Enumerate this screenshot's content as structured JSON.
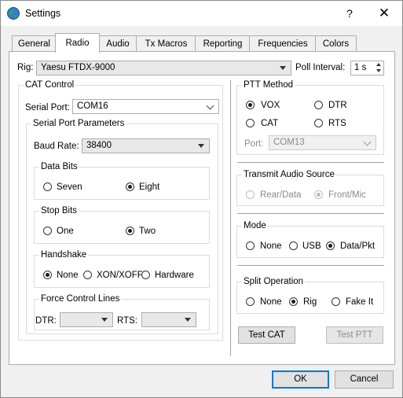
{
  "window": {
    "title": "Settings",
    "help_glyph": "?",
    "close_glyph": "✕",
    "icon": "globe-icon"
  },
  "tabs": [
    "General",
    "Radio",
    "Audio",
    "Tx Macros",
    "Reporting",
    "Frequencies",
    "Colors"
  ],
  "active_tab": "Radio",
  "rig": {
    "label": "Rig:",
    "value": "Yaesu FTDX-9000"
  },
  "poll_interval": {
    "label": "Poll Interval:",
    "value": "1 s"
  },
  "cat_control": {
    "title": "CAT Control",
    "serial_port_label": "Serial Port:",
    "serial_port_value": "COM16",
    "serial_params": {
      "title": "Serial Port Parameters",
      "baud_rate_label": "Baud Rate:",
      "baud_rate_value": "38400",
      "data_bits": {
        "title": "Data Bits",
        "options": [
          "Seven",
          "Eight"
        ],
        "selected": "Eight"
      },
      "stop_bits": {
        "title": "Stop Bits",
        "options": [
          "One",
          "Two"
        ],
        "selected": "Two"
      },
      "handshake": {
        "title": "Handshake",
        "options": [
          "None",
          "XON/XOFF",
          "Hardware"
        ],
        "selected": "None"
      },
      "force_control": {
        "title": "Force Control Lines",
        "dtr_label": "DTR:",
        "dtr_value": "",
        "rts_label": "RTS:",
        "rts_value": ""
      }
    }
  },
  "ptt_method": {
    "title": "PTT Method",
    "options": [
      "VOX",
      "DTR",
      "CAT",
      "RTS"
    ],
    "selected": "VOX",
    "port_label": "Port:",
    "port_value": "COM13"
  },
  "transmit_audio_source": {
    "title": "Transmit Audio Source",
    "options": [
      "Rear/Data",
      "Front/Mic"
    ],
    "selected": "Front/Mic"
  },
  "mode": {
    "title": "Mode",
    "options": [
      "None",
      "USB",
      "Data/Pkt"
    ],
    "selected": "Data/Pkt"
  },
  "split_operation": {
    "title": "Split Operation",
    "options": [
      "None",
      "Rig",
      "Fake It"
    ],
    "selected": "Rig"
  },
  "buttons": {
    "test_cat": "Test CAT",
    "test_ptt": "Test PTT",
    "ok": "OK",
    "cancel": "Cancel"
  }
}
